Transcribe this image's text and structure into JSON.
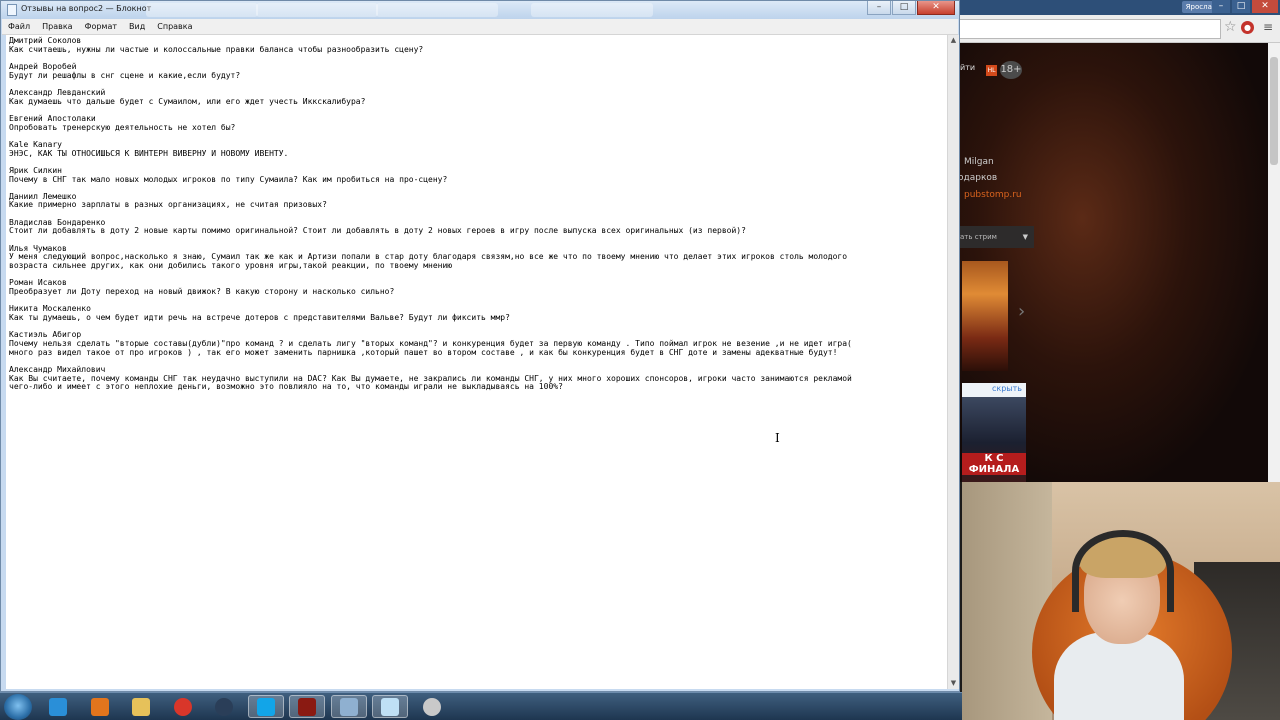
{
  "browser": {
    "user_badge": "Ярослав",
    "site": {
      "nav_text": "йти",
      "hk_badge": "HL",
      "age_badge": "18+",
      "user_name": "Milgan",
      "gifts_text": "одарков",
      "link_text": "pubstomp.ru",
      "stream_select_label": "ать стрим",
      "promo_hide": "скрыть",
      "promo_title": "К С ФИНАЛА"
    }
  },
  "notepad": {
    "title": "Отзывы на вопрос2 — Блокнот",
    "menu": [
      "Файл",
      "Правка",
      "Формат",
      "Вид",
      "Справка"
    ],
    "content": "Дмитрий Соколов\nКак считаешь, нужны ли частые и колоссальные правки баланса чтобы разнообразить сцену?\n\nАндрей Воробей\nБудут ли решафлы в снг сцене и какие,если будут?\n\nАлександр Левданский\nКак думаешь что дальше будет с Сумаилом, или его ждет учесть Иккскалибура?\n\nЕвгений Апостолаки\nОпробовать тренерскую деятельность не хотел бы?\n\nKale Kanary\nЭНЭС, КАК ТЫ ОТНОСИШЬСЯ К ВИНТЕРН ВИВЕРНУ И НОВОМУ ИВЕНТУ.\n\nЯрик Силкин\nПочему в СНГ так мало новых молодых игроков по типу Сумаила? Как им пробиться на про-сцену?\n\nДаниил Лемешко\nКакие примерно зарплаты в разных организациях, не считая призовых?\n\nВладислав Бондаренко\nСтоит ли добавлять в доту 2 новые карты помимо оригинальной? Стоит ли добавлять в доту 2 новых героев в игру после выпуска всех оригинальных (из первой)?\n\nИлья Чумаков\nУ меня следующий вопрос,насколько я знаю, Сумаил так же как и Артизи попали в стар доту благодаря связям,но все же что по твоему мнению что делает этих игроков столь молодого\nвозраста сильнее других, как они добились такого уровня игры,такой реакции, по твоему мнению\n\nРоман Исаков\nПреобразует ли Доту переход на новый движок? В какую сторону и насколько сильно?\n\nНикита Москаленко\nКак ты думаешь, о чем будет идти речь на встрече дотеров с представителями Вальве? Будут ли фиксить ммр?\n\nКастиэль Абигор\nПочему нельзя сделать \"вторые составы(дубли)\"про команд ? и сделать лигу \"вторых команд\"? и конкуренция будет за первую команду . Типо поймал игрок не везение ,и не идет игра(\nмного раз видел такое от про игроков ) , так его может заменить парнишка ,который пашет во втором составе , и как бы конкуренция будет в СНГ доте и замены адекватные будут!\n\nАлександр Михайлович\nКак Вы считаете, почему команды СНГ так неудачно выступили на DAC? Как Вы думаете, не закрались ли команды СНГ, у них много хороших спонсоров, игроки часто занимаются рекламой\nчего-либо и имеет с этого неплохие деньги, возможно это повлияло на то, что команды играли не выкладываясь на 100%?"
  },
  "colors": {
    "taskbar": "#1e3650",
    "notepad_frame": "#c7daf0",
    "close_button": "#c7402e",
    "link_orange": "#d9631e"
  },
  "taskbar": {
    "buttons": [
      {
        "name": "ie",
        "color": "#2a8fd8",
        "active": false
      },
      {
        "name": "media-player",
        "color": "#e2751d",
        "active": false
      },
      {
        "name": "explorer",
        "color": "#e6c15a",
        "active": false
      },
      {
        "name": "chrome",
        "color": "#d9362a",
        "active": false
      },
      {
        "name": "steam",
        "color": "#2a3e58",
        "active": false
      },
      {
        "name": "skype",
        "color": "#12a5e8",
        "active": true
      },
      {
        "name": "dota",
        "color": "#8a1a12",
        "active": true
      },
      {
        "name": "network",
        "color": "#8fb0d0",
        "active": true
      },
      {
        "name": "notepad",
        "color": "#bfe0f5",
        "active": true
      },
      {
        "name": "disc",
        "color": "#c9c9c9",
        "active": false
      }
    ]
  }
}
